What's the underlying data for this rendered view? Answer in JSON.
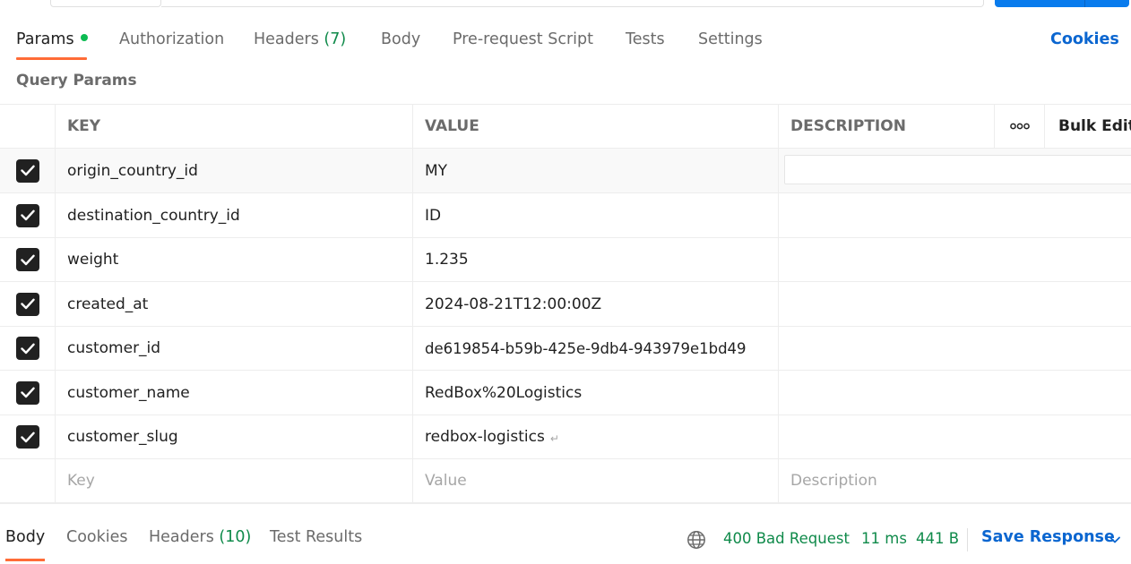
{
  "request_tabs": {
    "params": "Params",
    "authorization": "Authorization",
    "headers": "Headers",
    "headers_count": "(7)",
    "body": "Body",
    "prerequest": "Pre-request Script",
    "tests": "Tests",
    "settings": "Settings",
    "cookies": "Cookies"
  },
  "query_params": {
    "title": "Query Params",
    "columns": {
      "key": "KEY",
      "value": "VALUE",
      "description": "DESCRIPTION",
      "bulk_edit": "Bulk Edit"
    },
    "rows": [
      {
        "key": "origin_country_id",
        "value": "MY",
        "checked": true
      },
      {
        "key": "destination_country_id",
        "value": "ID",
        "checked": true
      },
      {
        "key": "weight",
        "value": "1.235",
        "checked": true
      },
      {
        "key": "created_at",
        "value": "2024-08-21T12:00:00Z",
        "checked": true
      },
      {
        "key": "customer_id",
        "value": "de619854-b59b-425e-9db4-943979e1bd49",
        "checked": true
      },
      {
        "key": "customer_name",
        "value": "RedBox%20Logistics",
        "checked": true
      },
      {
        "key": "customer_slug",
        "value": "redbox-logistics",
        "checked": true
      }
    ],
    "placeholders": {
      "key": "Key",
      "value": "Value",
      "description": "Description"
    }
  },
  "response_tabs": {
    "body": "Body",
    "cookies": "Cookies",
    "headers": "Headers",
    "headers_count": "(10)",
    "test_results": "Test Results"
  },
  "response_status": {
    "status": "400 Bad Request",
    "time": "11 ms",
    "size": "441 B",
    "save_response": "Save Response"
  },
  "colors": {
    "accent_tab": "#ff6c37",
    "link_blue": "#0b66d0",
    "status_green": "#0f8a4a",
    "send_button": "#097bed"
  }
}
